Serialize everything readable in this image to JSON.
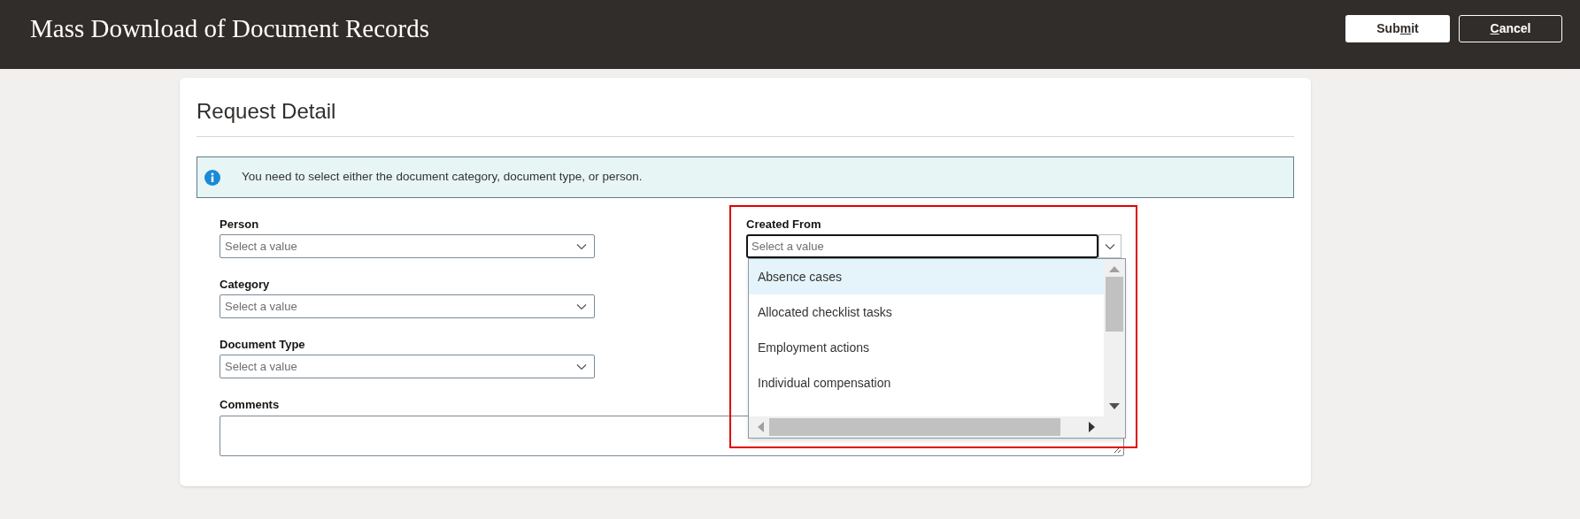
{
  "header": {
    "title": "Mass Download of Document Records",
    "buttons": [
      {
        "kind": "primary",
        "before": "Sub",
        "key": "m",
        "after": "it"
      },
      {
        "kind": "secondary",
        "key": "C",
        "after": "ancel"
      }
    ]
  },
  "panel": {
    "title": "Request Detail",
    "info_message": "You need to select either the document category, document type, or person.",
    "left_fields": [
      {
        "label": "Person",
        "placeholder": "Select a value"
      },
      {
        "label": "Category",
        "placeholder": "Select a value"
      },
      {
        "label": "Document Type",
        "placeholder": "Select a value"
      }
    ],
    "comments": {
      "label": "Comments"
    },
    "created_from": {
      "label": "Created From",
      "placeholder": "Select a value",
      "options": [
        {
          "label": "Absence cases",
          "selected": true
        },
        {
          "label": "Allocated checklist tasks",
          "selected": false
        },
        {
          "label": "Employment actions",
          "selected": false
        },
        {
          "label": "Individual compensation",
          "selected": false
        }
      ]
    }
  }
}
